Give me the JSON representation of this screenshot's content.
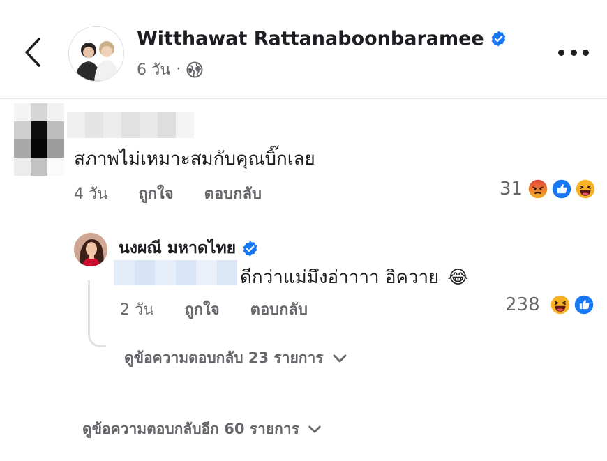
{
  "header": {
    "name": "Witthawat Rattanaboonbaramee",
    "time": "6 วัน",
    "separator": "·",
    "icons": {
      "back": "chevron-left-icon",
      "verified": "verified-badge-icon",
      "privacy": "globe-icon",
      "more": "more-horizontal-icon"
    }
  },
  "comments": [
    {
      "text": "สภาพไม่เหมาะสมกับคุณบิ๊กเลย",
      "time": "4 วัน",
      "like_label": "ถูกใจ",
      "reply_label": "ตอบกลับ",
      "reaction_count": "31",
      "reactions": [
        "angry",
        "like",
        "haha"
      ],
      "replies": [
        {
          "author": "นงผณี มหาดไทย",
          "verified": true,
          "text": "ดีกว่าแม่มึงอ่าาาา อิควาย",
          "emoji": "😂",
          "time": "2 วัน",
          "like_label": "ถูกใจ",
          "reply_label": "ตอบกลับ",
          "reaction_count": "238",
          "reactions": [
            "haha",
            "like"
          ]
        }
      ],
      "view_replies_label": "ดูข้อความตอบกลับ 23 รายการ"
    }
  ],
  "view_more_label": "ดูข้อความตอบกลับอีก 60 รายการ",
  "colors": {
    "verified": "#1877f2",
    "like": "#1877f2",
    "angry": "#e9710f",
    "haha": "#f7b125",
    "secondary_text": "#65676b",
    "divider": "#e4e6eb"
  }
}
